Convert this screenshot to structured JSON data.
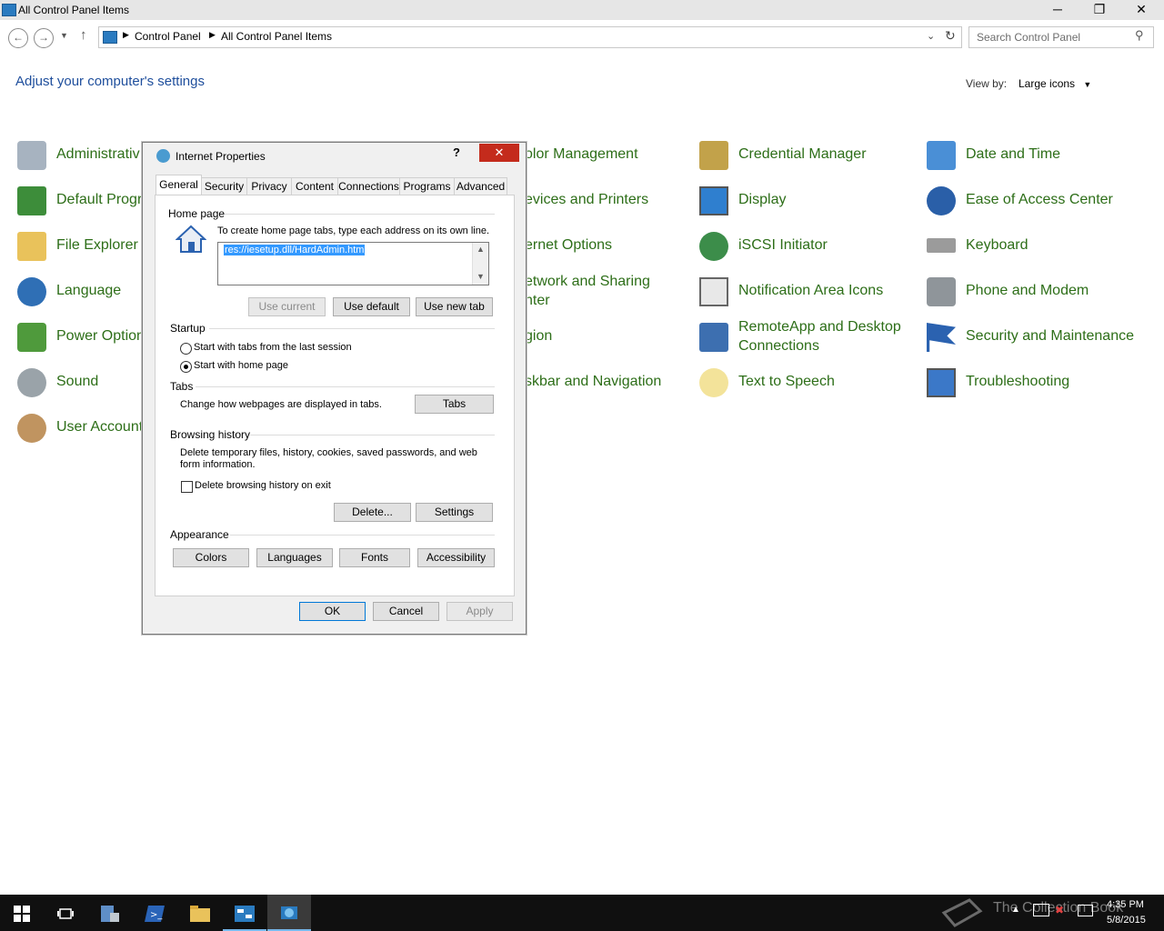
{
  "window": {
    "title": "All Control Panel Items"
  },
  "address": {
    "crumbs": [
      "Control Panel",
      "All Control Panel Items"
    ],
    "search_placeholder": "Search Control Panel"
  },
  "content": {
    "heading": "Adjust your computer's settings",
    "viewby_label": "View by:",
    "viewby_value": "Large icons"
  },
  "items": {
    "col1": [
      "Administrativ",
      "Default Progr",
      "File Explorer C",
      "Language",
      "Power Option",
      "Sound",
      "User Accounts"
    ],
    "col2": [
      "olor Management",
      "evices and Printers",
      "ernet Options",
      "etwork and Sharing",
      "nter",
      "gion",
      "skbar and Navigation"
    ],
    "col3": [
      "Credential Manager",
      "Display",
      "iSCSI Initiator",
      "Notification Area Icons",
      "RemoteApp and Desktop",
      "Connections",
      "Text to Speech"
    ],
    "col4": [
      "Date and Time",
      "Ease of Access Center",
      "Keyboard",
      "Phone and Modem",
      "Security and Maintenance",
      "Troubleshooting"
    ]
  },
  "dialog": {
    "title": "Internet Properties",
    "help": "?",
    "close": "✕",
    "tabs": [
      "General",
      "Security",
      "Privacy",
      "Content",
      "Connections",
      "Programs",
      "Advanced"
    ],
    "homepage": {
      "label": "Home page",
      "hint": "To create home page tabs, type each address on its own line.",
      "value": "res://iesetup.dll/HardAdmin.htm",
      "btn_current": "Use current",
      "btn_default": "Use default",
      "btn_newtab": "Use new tab"
    },
    "startup": {
      "label": "Startup",
      "opt1": "Start with tabs from the last session",
      "opt2": "Start with home page"
    },
    "tabs_group": {
      "label": "Tabs",
      "desc": "Change how webpages are displayed in tabs.",
      "btn": "Tabs"
    },
    "history": {
      "label": "Browsing history",
      "desc1": "Delete temporary files, history, cookies, saved passwords, and web",
      "desc2": "form information.",
      "checkbox": "Delete browsing history on exit",
      "btn_delete": "Delete...",
      "btn_settings": "Settings"
    },
    "appearance": {
      "label": "Appearance",
      "btn_colors": "Colors",
      "btn_languages": "Languages",
      "btn_fonts": "Fonts",
      "btn_accessibility": "Accessibility"
    },
    "ok": "OK",
    "cancel": "Cancel",
    "apply": "Apply"
  },
  "taskbar": {
    "time": "4:35 PM",
    "date": "5/8/2015",
    "watermark": "The Collection Book"
  },
  "colors": {
    "link": "#2d6e18",
    "heading": "#1e4e9c",
    "taskbar": "#101010",
    "active_task": "#3a3a3a"
  }
}
